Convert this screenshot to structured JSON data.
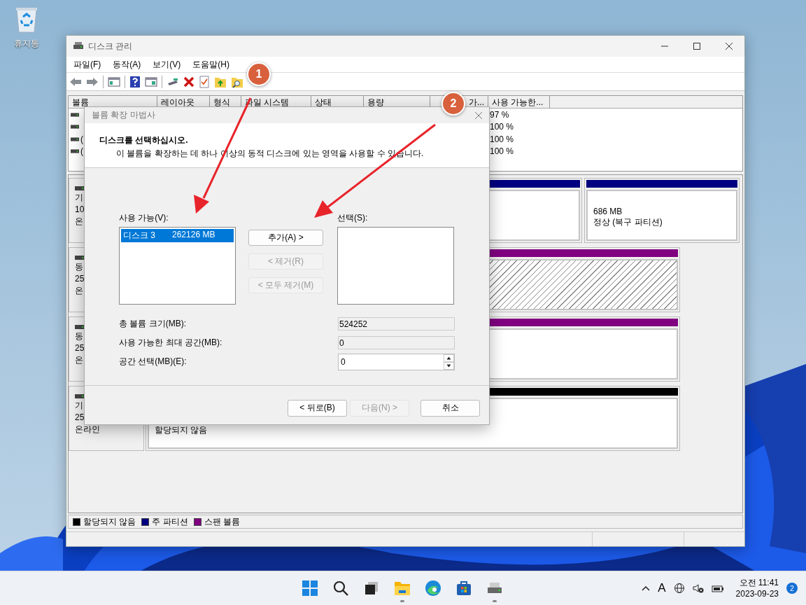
{
  "desktop": {
    "icons": [
      {
        "label": "휴지통"
      }
    ]
  },
  "window": {
    "title": "디스크 관리",
    "menu": [
      "파일(F)",
      "동작(A)",
      "보기(V)",
      "도움말(H)"
    ],
    "volume_list": {
      "columns": [
        "볼륨",
        "레이아웃",
        "형식",
        "파일 시스템",
        "상태",
        "용량",
        "가...",
        "사용 가능한..."
      ],
      "rows": [
        {
          "percent": "97 %"
        },
        {
          "percent": "100 %"
        },
        {
          "name": "(",
          "percent": "100 %"
        },
        {
          "name": "(",
          "percent": "100 %"
        }
      ]
    },
    "disks": [
      {
        "label": [
          "기",
          "10",
          "온"
        ],
        "partitions": [
          {
            "kind": "primary",
            "selected": false
          },
          {
            "kind": "primary",
            "selected": false,
            "lines": [
              "686 MB",
              "정상 (복구 파티션)"
            ]
          }
        ]
      },
      {
        "label": [
          "동",
          "25",
          "온"
        ],
        "partitions": [
          {
            "kind": "spanned",
            "selected": true
          }
        ]
      },
      {
        "label": [
          "동",
          "25",
          "온"
        ],
        "partitions": [
          {
            "kind": "spanned",
            "selected": false
          }
        ]
      },
      {
        "label": [
          "기",
          "25",
          "온라인"
        ],
        "partitions": [
          {
            "kind": "unallocated",
            "selected": false,
            "lines": [
              "할당되지 않음"
            ]
          }
        ]
      }
    ],
    "legend": [
      {
        "label": "할당되지 않음",
        "color": "#000000"
      },
      {
        "label": "주 파티션",
        "color": "#000080"
      },
      {
        "label": "스팬 볼륨",
        "color": "#800080"
      }
    ]
  },
  "dialog": {
    "title": "볼륨 확장 마법사",
    "heading": "디스크를 선택하십시오.",
    "description": "이 볼륨을 확장하는 데 하나 이상의 동적 디스크에 있는 영역을 사용할 수 있습니다.",
    "available": {
      "label": "사용 가능(V):",
      "items": [
        {
          "name": "디스크 3",
          "size": "262126 MB",
          "selected": true
        }
      ]
    },
    "move_buttons": [
      {
        "label": "추가(A) >",
        "disabled": false
      },
      {
        "label": "< 제거(R)",
        "disabled": true
      },
      {
        "label": "< 모두 제거(M)",
        "disabled": true
      }
    ],
    "chosen": {
      "label": "선택(S):"
    },
    "fields": [
      {
        "label": "총 볼륨 크기(MB):",
        "value": "524252",
        "kind": "readonly"
      },
      {
        "label": "사용 가능한 최대 공간(MB):",
        "value": "0",
        "kind": "readonly"
      },
      {
        "label": "공간 선택(MB)(E):",
        "value": "0",
        "kind": "spinner"
      }
    ],
    "buttons": [
      {
        "label": "< 뒤로(B)",
        "disabled": false
      },
      {
        "label": "다음(N) >",
        "disabled": true
      },
      {
        "label": "취소",
        "disabled": false
      }
    ]
  },
  "annotations": [
    {
      "number": "1"
    },
    {
      "number": "2"
    }
  ],
  "taskbar": {
    "apps": [
      {
        "kind": "start",
        "running": false
      },
      {
        "kind": "search",
        "running": false
      },
      {
        "kind": "taskview",
        "running": false
      },
      {
        "kind": "explorer",
        "running": true
      },
      {
        "kind": "edge",
        "running": false
      },
      {
        "kind": "store",
        "running": false
      },
      {
        "kind": "diskmgmt",
        "running": true
      }
    ],
    "input_indicator": "A",
    "time": "오전 11:41",
    "date": "2023-09-23",
    "notifications": "2"
  }
}
